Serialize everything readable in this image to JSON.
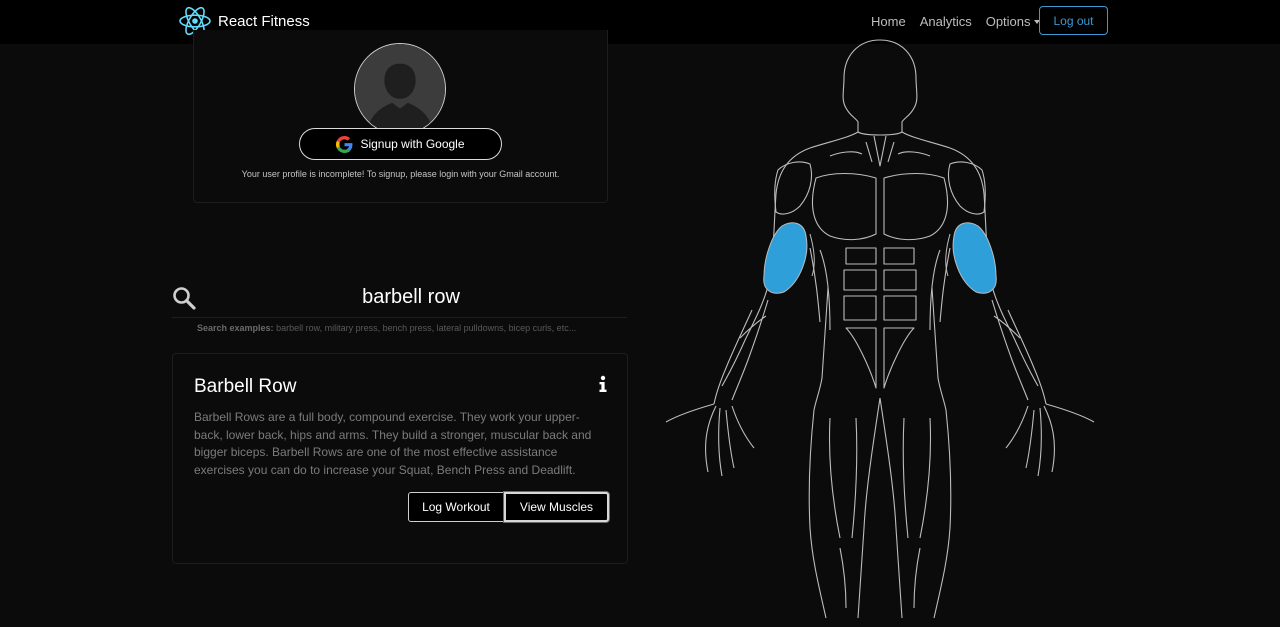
{
  "nav": {
    "brand": "React Fitness",
    "links": [
      {
        "label": "Home"
      },
      {
        "label": "Analytics"
      },
      {
        "label": "Options"
      }
    ],
    "logout_label": "Log out",
    "accent": "#3a9bd5"
  },
  "profile": {
    "avatar_icon": "user-silhouette-icon",
    "google_button": "Signup with Google",
    "message": "Your user profile is incomplete! To signup, please login with your Gmail account."
  },
  "search": {
    "icon": "search-icon",
    "value": "barbell row",
    "examples_label": "Search examples:",
    "examples": "barbell row, military press, bench press, lateral pulldowns, bicep curls, etc..."
  },
  "exercise": {
    "title": "Barbell Row",
    "info_icon": "info-icon",
    "description": "Barbell Rows are a full body, compound exercise. They work your upper-back, lower back, hips and arms. They build a stronger, muscular back and bigger biceps. Barbell Rows are one of the most effective assistance exercises you can do to increase your Squat, Bench Press and Deadlift.",
    "log_button": "Log Workout",
    "view_button": "View Muscles"
  },
  "muscle_map": {
    "highlighted": [
      "biceps-left",
      "biceps-right"
    ],
    "highlight_color": "#2e9fd8",
    "outline_color": "#bdbdbd"
  }
}
